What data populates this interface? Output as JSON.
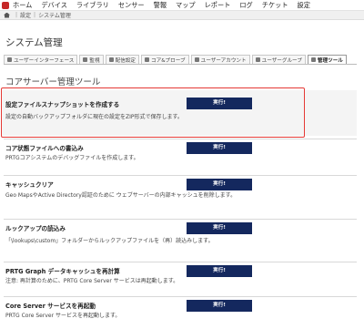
{
  "nav": {
    "items": [
      "ホーム",
      "デバイス",
      "ライブラリ",
      "センサー",
      "警報",
      "マップ",
      "レポート",
      "ログ",
      "チケット",
      "設定"
    ]
  },
  "breadcrumb": {
    "items": [
      "設定",
      "システム管理"
    ]
  },
  "page_title": "システム管理",
  "tabs": [
    {
      "label": "ユーザーインターフェース",
      "icon": "monitor-icon"
    },
    {
      "label": "監視",
      "icon": "eye-icon"
    },
    {
      "label": "配信設定",
      "icon": "mail-icon"
    },
    {
      "label": "コア&プローブ",
      "icon": "nodes-icon"
    },
    {
      "label": "ユーザーアカウント",
      "icon": "user-icon"
    },
    {
      "label": "ユーザーグループ",
      "icon": "group-icon"
    },
    {
      "label": "管理ツール",
      "icon": "wrench-icon",
      "active": true
    }
  ],
  "section_heading": "コアサーバー管理ツール",
  "run_label": "実行!",
  "tools": [
    {
      "name": "設定ファイルスナップショットを作成する",
      "desc": "設定の自動バックアップフォルダに現在の設定をZIP形式で保存します。"
    },
    {
      "name": "コア状態ファイルへの書込み",
      "desc": "PRTGコアシステムのデバッグファイルを作成します。"
    },
    {
      "name": "キャッシュクリア",
      "desc": "Geo MapsやActive Directory認証のために ウェブサーバーの内部キャッシュを削除します。"
    },
    {
      "name": "ルックアップの読込み",
      "desc": "「\\lookups\\custom」フォルダーからルックアップファイルを（再）読込みします。"
    },
    {
      "name": "PRTG Graph データキャッシュを再計算",
      "desc": "注意: 再計算のために、PRTG Core Server サービスは再起動します。"
    },
    {
      "name": "Core Server サービスを再起動",
      "desc": "PRTG Core Server サービスを再起動します。"
    }
  ],
  "colors": {
    "run_button": "#14285e",
    "highlight_border": "#e53935"
  }
}
